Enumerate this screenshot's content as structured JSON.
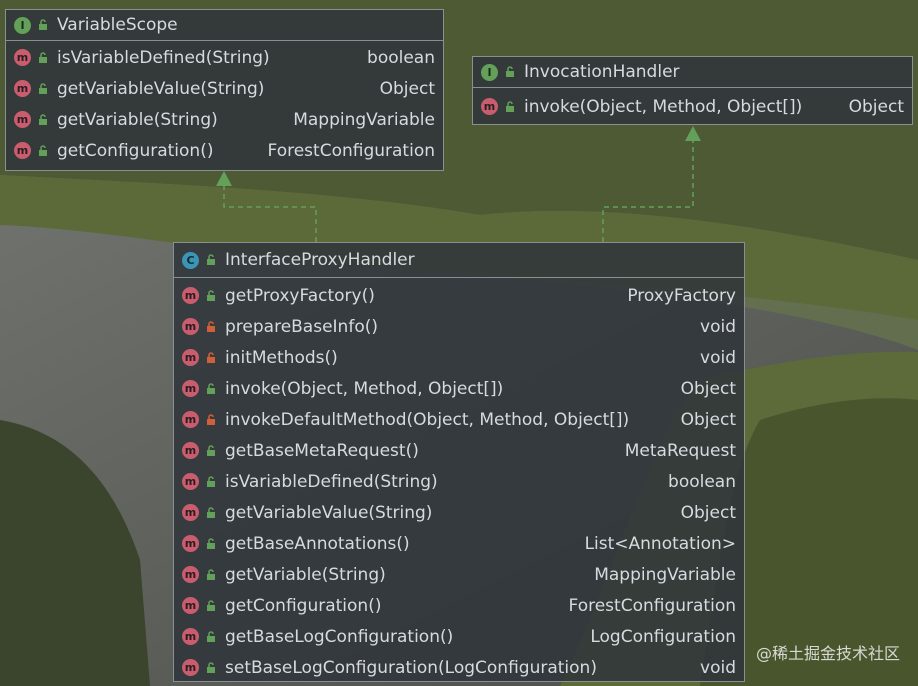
{
  "boxes": [
    {
      "key": "variable_scope",
      "kind": "interface",
      "kind_letter": "I",
      "title": "VariableScope",
      "methods": [
        {
          "name": "isVariableDefined(String)",
          "type": "boolean",
          "visibility": "public"
        },
        {
          "name": "getVariableValue(String)",
          "type": "Object",
          "visibility": "public"
        },
        {
          "name": "getVariable(String)",
          "type": "MappingVariable",
          "visibility": "public"
        },
        {
          "name": "getConfiguration()",
          "type": "ForestConfiguration",
          "visibility": "public"
        }
      ]
    },
    {
      "key": "invocation_handler",
      "kind": "interface",
      "kind_letter": "I",
      "title": "InvocationHandler",
      "methods": [
        {
          "name": "invoke(Object, Method, Object[])",
          "type": "Object",
          "visibility": "public"
        }
      ]
    },
    {
      "key": "interface_proxy_handler",
      "kind": "class",
      "kind_letter": "C",
      "title": "InterfaceProxyHandler",
      "methods": [
        {
          "name": "getProxyFactory()",
          "type": "ProxyFactory",
          "visibility": "public"
        },
        {
          "name": "prepareBaseInfo()",
          "type": "void",
          "visibility": "private"
        },
        {
          "name": "initMethods()",
          "type": "void",
          "visibility": "private"
        },
        {
          "name": "invoke(Object, Method, Object[])",
          "type": "Object",
          "visibility": "public"
        },
        {
          "name": "invokeDefaultMethod(Object, Method, Object[])",
          "type": "Object",
          "visibility": "private"
        },
        {
          "name": "getBaseMetaRequest()",
          "type": "MetaRequest",
          "visibility": "public"
        },
        {
          "name": "isVariableDefined(String)",
          "type": "boolean",
          "visibility": "public"
        },
        {
          "name": "getVariableValue(String)",
          "type": "Object",
          "visibility": "public"
        },
        {
          "name": "getBaseAnnotations()",
          "type": "List<Annotation>",
          "visibility": "public"
        },
        {
          "name": "getVariable(String)",
          "type": "MappingVariable",
          "visibility": "public"
        },
        {
          "name": "getConfiguration()",
          "type": "ForestConfiguration",
          "visibility": "public"
        },
        {
          "name": "getBaseLogConfiguration()",
          "type": "LogConfiguration",
          "visibility": "public"
        },
        {
          "name": "setBaseLogConfiguration(LogConfiguration)",
          "type": "void",
          "visibility": "public"
        }
      ]
    }
  ],
  "method_icon_letter": "m",
  "colors": {
    "method_icon": "#c95d6e",
    "interface_icon": "#63a05a",
    "class_icon": "#3b96b4",
    "public_lock": "#63a05a",
    "private_lock": "#d0603a",
    "connector": "#63a05a"
  },
  "watermark": "@稀土掘金技术社区"
}
